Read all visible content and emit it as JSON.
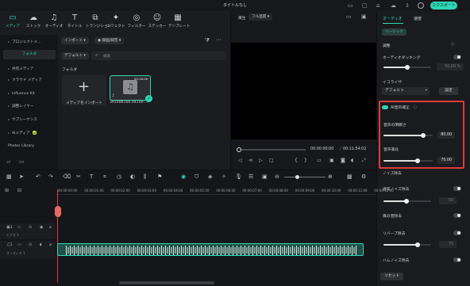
{
  "window": {
    "title": "タイトルなし",
    "export_label": "エクスポート"
  },
  "toolbar": {
    "items": [
      {
        "icon": "folder-icon",
        "glyph": "▭",
        "label": "メディア"
      },
      {
        "icon": "cloud-icon",
        "glyph": "☁",
        "label": "ストック"
      },
      {
        "icon": "music-icon",
        "glyph": "♫",
        "label": "オーディオ"
      },
      {
        "icon": "text-icon",
        "glyph": "T",
        "label": "タイトル"
      },
      {
        "icon": "transition-icon",
        "glyph": "⧉",
        "label": "トランジション"
      },
      {
        "icon": "effect-icon",
        "glyph": "✦",
        "label": "エフェクト"
      },
      {
        "icon": "filter-icon",
        "glyph": "◎",
        "label": "フィルター"
      },
      {
        "icon": "sticker-icon",
        "glyph": "☺",
        "label": "ステッカー"
      },
      {
        "icon": "template-icon",
        "glyph": "▦",
        "label": "テンプレート"
      }
    ]
  },
  "sidebar": {
    "items": [
      {
        "label": "プロジェクトメ...",
        "kind": "parent"
      },
      {
        "label": "フォルダ",
        "kind": "selected"
      },
      {
        "label": "共有メディア",
        "kind": "parent"
      },
      {
        "label": "クラウド メディア",
        "kind": "parent"
      },
      {
        "label": "Influence Kit",
        "kind": "parent"
      },
      {
        "label": "調整レイヤー",
        "kind": "parent"
      },
      {
        "label": "サブシーケンス",
        "kind": "parent"
      },
      {
        "label": "AIメディア",
        "kind": "parent",
        "badge": "AI"
      },
      {
        "label": "Photos Library",
        "kind": "plain"
      }
    ]
  },
  "media": {
    "import_button": "インポート",
    "record_button": "録画/録音",
    "default_dropdown": "デフォルト",
    "search_placeholder": "検索",
    "folder_label": "フォルダ",
    "import_card_label": "メディアをインポート",
    "clip_name": "391486166-44100-...",
    "clip_duration": "00:18:38"
  },
  "preview": {
    "tab_playback": "再生",
    "quality": "フル品質",
    "current_time": "00:00:00:00",
    "separator": "/",
    "total_time": "00:11:54:02"
  },
  "right": {
    "tab_audio": "オーディオ",
    "tab_speed": "速度",
    "basic_button": "ベーシック",
    "adjust_label": "調整",
    "ducking_label": "オーディオダッキング",
    "ducking_value": "50.00",
    "ducking_unit": "%",
    "eq_label": "イコライザ",
    "eq_value": "デフォルト",
    "eq_settings": "設定",
    "ai_voice_label": "AI音声補正",
    "ai_badge": "AI",
    "voice_clarity_label": "音声の明瞭さ",
    "voice_clarity_value": "80.00",
    "voice_clarity_level": 0.8,
    "voice_beautify_label": "音声美化",
    "voice_beautify_value": "70.00",
    "voice_beautify_level": 0.7,
    "noise_label": "ノイズ除去",
    "normal_noise_label": "通常ノイズ除去",
    "normal_noise_value": "50",
    "wind_noise_label": "風の音除去",
    "reverb_label": "リバーブ除去",
    "reverb_value": "70",
    "hum_label": "ハムノイズ除去",
    "reset_button": "リセット",
    "accent_color": "#2fd6b5",
    "highlight_color": "#e0393b"
  },
  "timeline": {
    "ticks": [
      "00:00:00:00",
      "00:00:01:00",
      "00:00:02:00",
      "00:00:03:00",
      "00:00:04:00",
      "00:00:05:00",
      "00:00:06:00",
      "00:00:07:00",
      "00:00:08:00",
      "00:00:09:00",
      "00:00:10:00",
      "00:00:11:00",
      "00:00:12:00"
    ],
    "video_track_label": "ビデオ 1",
    "audio_track_label": "オーディオ 1"
  }
}
